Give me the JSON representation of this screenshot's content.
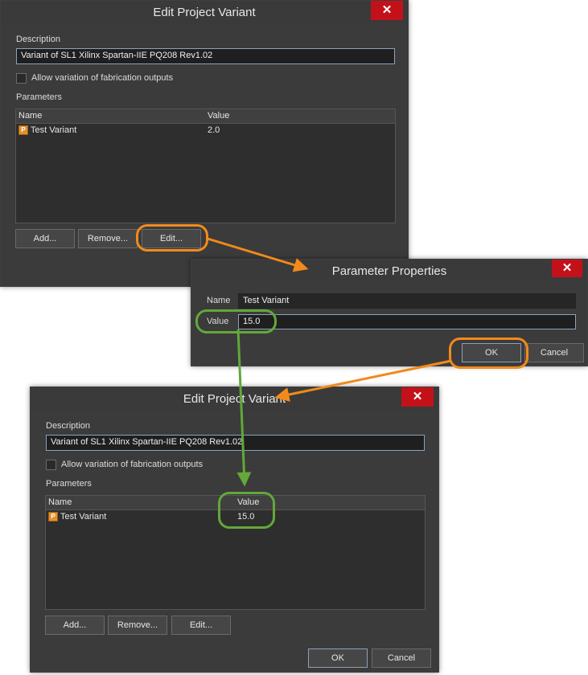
{
  "dialog1": {
    "title": "Edit Project Variant",
    "close": "✕",
    "description_label": "Description",
    "description_value": "Variant of SL1 Xilinx Spartan-IIE PQ208 Rev1.02",
    "allow_variation_label": "Allow variation of fabrication outputs",
    "parameters_label": "Parameters",
    "columns": [
      "Name",
      "Value"
    ],
    "rows": [
      {
        "name": "Test Variant",
        "value": "2.0",
        "icon": "P"
      }
    ],
    "buttons": {
      "add": "Add...",
      "remove": "Remove...",
      "edit": "Edit..."
    }
  },
  "dialog2": {
    "title": "Parameter Properties",
    "close": "✕",
    "name_label": "Name",
    "name_value": "Test Variant",
    "value_label": "Value",
    "value_value": "15.0",
    "buttons": {
      "ok": "OK",
      "cancel": "Cancel"
    }
  },
  "dialog3": {
    "title": "Edit Project Variant",
    "close": "✕",
    "description_label": "Description",
    "description_value": "Variant of SL1 Xilinx Spartan-IIE PQ208 Rev1.02",
    "allow_variation_label": "Allow variation of fabrication outputs",
    "parameters_label": "Parameters",
    "columns": [
      "Name",
      "Value"
    ],
    "rows": [
      {
        "name": "Test Variant",
        "value": "15.0",
        "icon": "P"
      }
    ],
    "buttons": {
      "add": "Add...",
      "remove": "Remove...",
      "edit": "Edit...",
      "ok": "OK",
      "cancel": "Cancel"
    }
  },
  "colors": {
    "highlight_orange": "#f28a1a",
    "highlight_green": "#62a83a",
    "close_red": "#c3111a"
  }
}
